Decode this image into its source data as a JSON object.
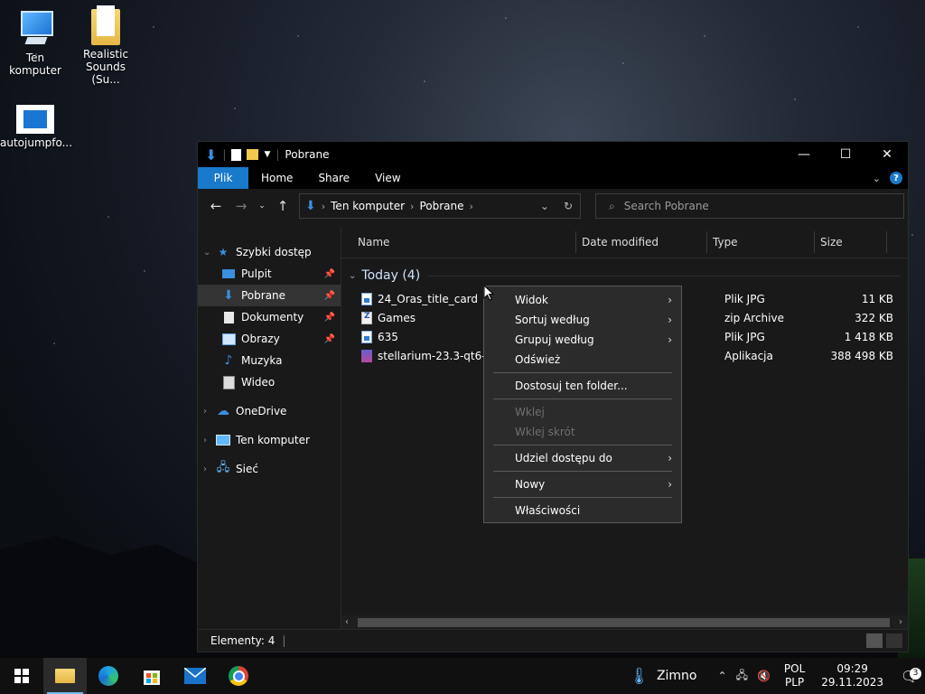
{
  "desktop": {
    "icons": [
      {
        "label": "Ten komputer",
        "icon": "computer-icon"
      },
      {
        "label": "Realistic Sounds (Su...",
        "icon": "folder-icon"
      },
      {
        "label": "autojumpfo...",
        "icon": "application-icon"
      }
    ]
  },
  "window": {
    "title": "Pobrane",
    "controls": {
      "minimize": "—",
      "maximize": "☐",
      "close": "✕"
    },
    "ribbon_tabs": [
      "Plik",
      "Home",
      "Share",
      "View"
    ],
    "help": "?",
    "address": {
      "crumbs": [
        "Ten komputer",
        "Pobrane"
      ]
    },
    "search_placeholder": "Search Pobrane"
  },
  "sidebar": {
    "items": [
      {
        "label": "Szybki dostęp",
        "icon": "star-icon",
        "level": 0
      },
      {
        "label": "Pulpit",
        "icon": "desktop-icon",
        "level": 1,
        "pinned": true
      },
      {
        "label": "Pobrane",
        "icon": "download-icon",
        "level": 1,
        "pinned": true,
        "active": true
      },
      {
        "label": "Dokumenty",
        "icon": "document-icon",
        "level": 1,
        "pinned": true
      },
      {
        "label": "Obrazy",
        "icon": "pictures-icon",
        "level": 1,
        "pinned": true
      },
      {
        "label": "Muzyka",
        "icon": "music-icon",
        "level": 1
      },
      {
        "label": "Wideo",
        "icon": "video-icon",
        "level": 1
      },
      {
        "label": "OneDrive",
        "icon": "cloud-icon",
        "level": 0
      },
      {
        "label": "Ten komputer",
        "icon": "computer-icon",
        "level": 0
      },
      {
        "label": "Sieć",
        "icon": "network-icon",
        "level": 0
      }
    ]
  },
  "columns": [
    "Name",
    "Date modified",
    "Type",
    "Size"
  ],
  "group": {
    "label": "Today (4)"
  },
  "files": [
    {
      "name": "24_Oras_title_card",
      "type": "Plik JPG",
      "size": "11 KB",
      "icon": "jpg"
    },
    {
      "name": "Games",
      "type": "zip Archive",
      "size": "322 KB",
      "icon": "zip"
    },
    {
      "name": "635",
      "type": "Plik JPG",
      "size": "1 418 KB",
      "icon": "jpg"
    },
    {
      "name": "stellarium-23.3-qt6-wi",
      "type": "Aplikacja",
      "size": "388 498 KB",
      "icon": "exe"
    }
  ],
  "status": {
    "items_text": "Elementy: 4"
  },
  "context_menu": {
    "items": [
      {
        "label": "Widok",
        "submenu": true
      },
      {
        "label": "Sortuj według",
        "submenu": true
      },
      {
        "label": "Grupuj według",
        "submenu": true
      },
      {
        "label": "Odśwież"
      },
      {
        "sep": true
      },
      {
        "label": "Dostosuj ten folder..."
      },
      {
        "sep": true
      },
      {
        "label": "Wklej",
        "disabled": true
      },
      {
        "label": "Wklej skrót",
        "disabled": true
      },
      {
        "sep": true
      },
      {
        "label": "Udziel dostępu do",
        "submenu": true
      },
      {
        "sep": true
      },
      {
        "label": "Nowy",
        "submenu": true
      },
      {
        "sep": true
      },
      {
        "label": "Właściwości"
      }
    ]
  },
  "taskbar": {
    "weather": "Zimno",
    "lang_top": "POL",
    "lang_bottom": "PLP",
    "time": "09:29",
    "date": "29.11.2023",
    "notifications": "3"
  },
  "colors": {
    "accent": "#1979ca",
    "bg": "#191919"
  }
}
